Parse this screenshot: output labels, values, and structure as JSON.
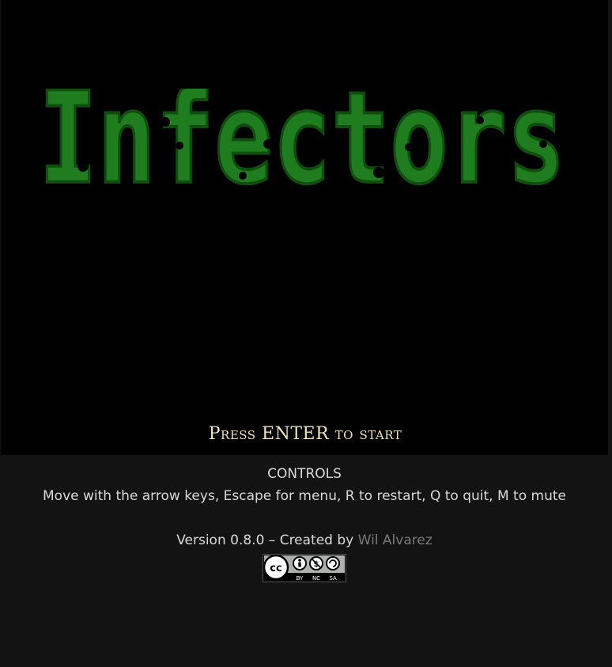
{
  "game": {
    "title": "Infectors",
    "prompt": "Press ENTER to start",
    "colors": {
      "logo_fill": "#1f7d1f",
      "logo_shade": "#0e4f0e",
      "logo_highlight": "#35a635",
      "prompt_text": "#efe3b6",
      "canvas_bg": "#000000",
      "page_bg": "#131313"
    }
  },
  "footer": {
    "controls_title": "CONTROLS",
    "controls_text": "Move with the arrow keys, Escape for menu, R to restart, Q to quit, M to mute",
    "version_text": "Version 0.8.0 – Created by ",
    "author": "Wil Alvarez",
    "license": {
      "icon": "cc-by-nc-sa-icon",
      "cc": "cc",
      "terms": [
        "BY",
        "NC",
        "SA"
      ]
    }
  }
}
